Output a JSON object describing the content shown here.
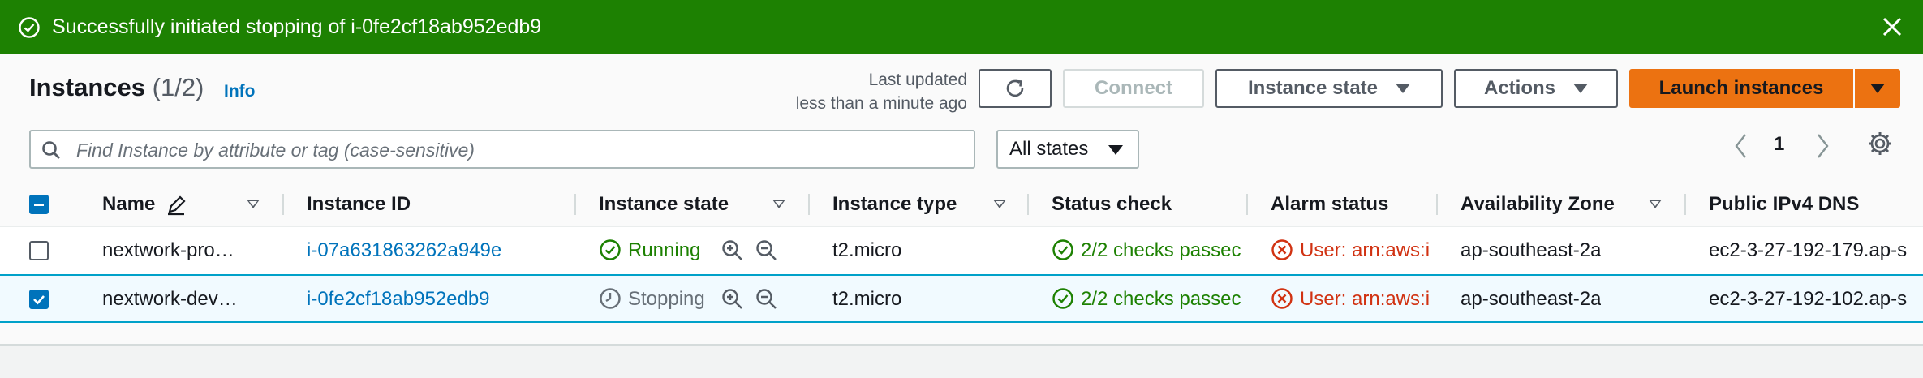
{
  "flash": {
    "message": "Successfully initiated stopping of i-0fe2cf18ab952edb9",
    "color": "#1d8102"
  },
  "header": {
    "title": "Instances",
    "count": "(1/2)",
    "info_label": "Info",
    "last_updated_line1": "Last updated",
    "last_updated_line2": "less than a minute ago",
    "connect_label": "Connect",
    "instance_state_label": "Instance state",
    "actions_label": "Actions",
    "launch_label": "Launch instances",
    "accent_color": "#ec7211"
  },
  "filter": {
    "search_placeholder": "Find Instance by attribute or tag (case-sensitive)",
    "state_filter": "All states"
  },
  "pagination": {
    "current_page": "1"
  },
  "table": {
    "columns": [
      "Name",
      "Instance ID",
      "Instance state",
      "Instance type",
      "Status check",
      "Alarm status",
      "Availability Zone",
      "Public IPv4 DNS"
    ],
    "rows": [
      {
        "selected": false,
        "name": "nextwork-pro…",
        "instance_id": "i-07a631863262a949e",
        "state": "Running",
        "type": "t2.micro",
        "status_check": "2/2 checks passec",
        "alarm": "User: arn:aws:i",
        "az": "ap-southeast-2a",
        "dns": "ec2-3-27-192-179.ap-s"
      },
      {
        "selected": true,
        "name": "nextwork-dev…",
        "instance_id": "i-0fe2cf18ab952edb9",
        "state": "Stopping",
        "type": "t2.micro",
        "status_check": "2/2 checks passec",
        "alarm": "User: arn:aws:i",
        "az": "ap-southeast-2a",
        "dns": "ec2-3-27-192-102.ap-s"
      }
    ]
  }
}
